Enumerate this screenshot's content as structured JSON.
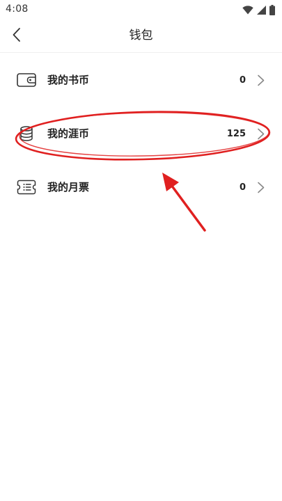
{
  "status_bar": {
    "time": "4:08",
    "icons": [
      "wifi-icon",
      "signal-icon",
      "battery-icon"
    ]
  },
  "header": {
    "title": "钱包",
    "back_icon": "chevron-left-icon"
  },
  "wallet": {
    "items": [
      {
        "label": "我的书币",
        "value": "0",
        "icon": "wallet-icon"
      },
      {
        "label": "我的涯币",
        "value": "125",
        "icon": "coin-stack-icon"
      },
      {
        "label": "我的月票",
        "value": "0",
        "icon": "ticket-icon"
      }
    ]
  },
  "annotation": {
    "color": "#e02020",
    "highlighted_item": "我的涯币"
  },
  "colors": {
    "text": "#222222",
    "icon": "#333333",
    "chevron": "#888888",
    "divider": "#efefef",
    "annotation": "#e02020"
  }
}
